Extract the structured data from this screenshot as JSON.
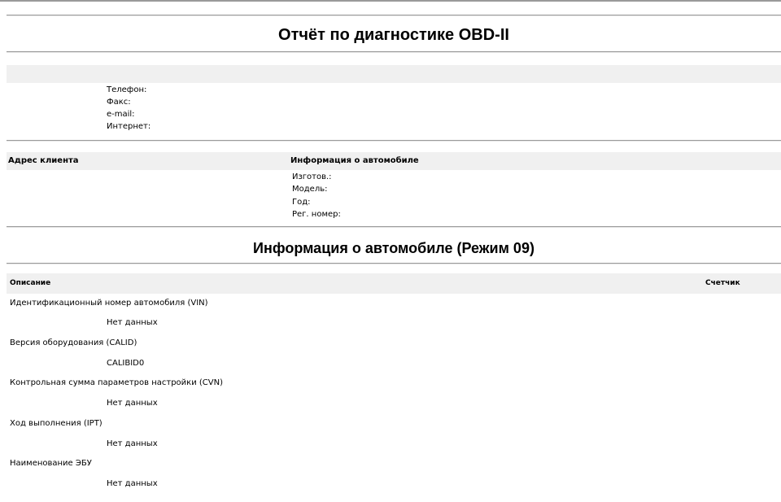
{
  "report": {
    "title": "Отчёт по диагностике OBD-II"
  },
  "contact": {
    "phone_label": "Телефон:",
    "fax_label": "Факс:",
    "email_label": "e-mail:",
    "internet_label": "Интернет:"
  },
  "client": {
    "address_header": "Адрес клиента"
  },
  "vehicle": {
    "header": "Информация о автомобиле",
    "make_label": "Изготов.:",
    "model_label": "Модель:",
    "year_label": "Год:",
    "reg_label": "Рег. номер:"
  },
  "mode09": {
    "title": "Информация о автомобиле (Режим 09)",
    "col_description": "Описание",
    "col_counter": "Счетчик",
    "rows": [
      {
        "description": "Идентификационный номер автомобиля (VIN)",
        "value": "Нет данных"
      },
      {
        "description": "Версия оборудования (CALID)",
        "value": "CALIBID0"
      },
      {
        "description": "Контрольная сумма параметров настройки (CVN)",
        "value": "Нет данных"
      },
      {
        "description": "Ход выполнения (IPT)",
        "value": "Нет данных"
      },
      {
        "description": "Наименование ЭБУ",
        "value": "Нет данных"
      }
    ]
  }
}
